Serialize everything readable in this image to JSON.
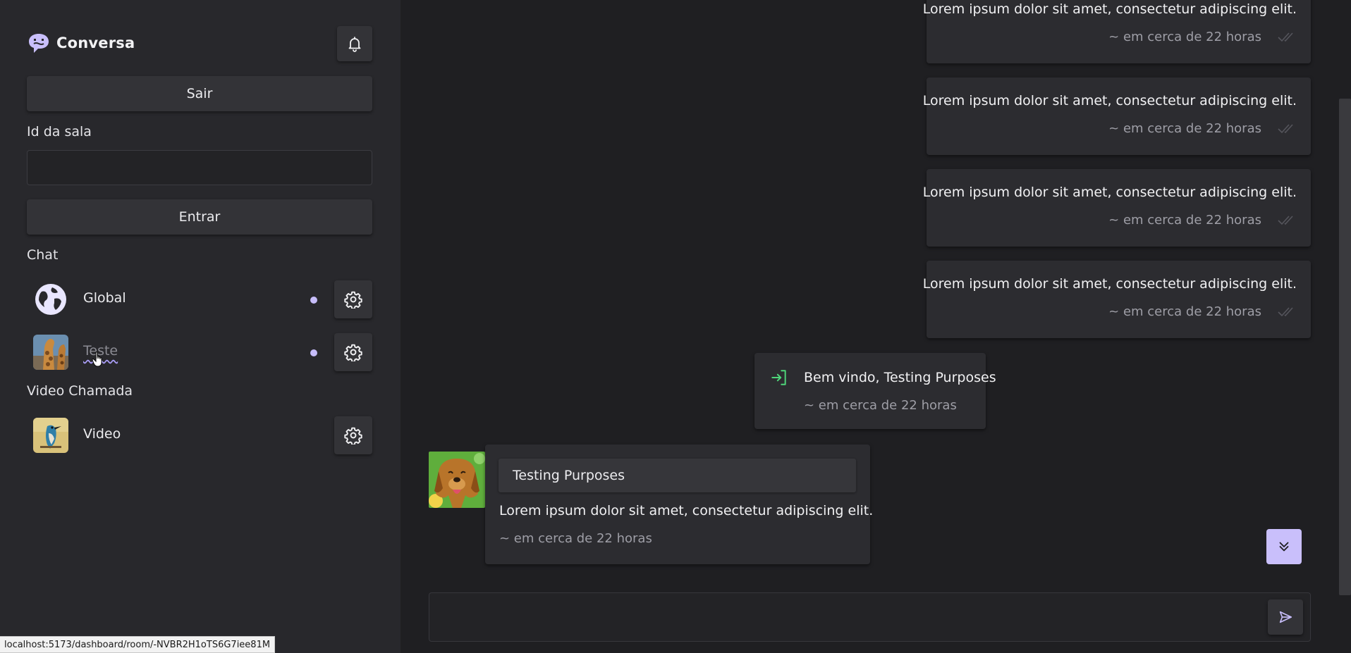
{
  "colors": {
    "background": "#1f1f22",
    "sidebar": "#28282c",
    "card": "#2c2c30",
    "accent": "#c9bffb",
    "enter_icon": "#4fd67a"
  },
  "sidebar": {
    "brand": {
      "name": "Conversa",
      "icon": "chat-bubble-logo-icon"
    },
    "notifications_icon": "bell-icon",
    "logout_label": "Sair",
    "room_id": {
      "label": "Id da sala",
      "value": "",
      "placeholder": ""
    },
    "enter_label": "Entrar",
    "chat_section_label": "Chat",
    "chat_rooms": [
      {
        "name": "Global",
        "avatar": "globe-icon",
        "unread": true,
        "settings_icon": "gear-icon"
      },
      {
        "name": "Teste",
        "avatar": "giraffe-photo",
        "unread": true,
        "settings_icon": "gear-icon"
      }
    ],
    "video_section_label": "Video Chamada",
    "video_rooms": [
      {
        "name": "Video",
        "avatar": "bird-photo",
        "settings_icon": "gear-icon"
      }
    ]
  },
  "chat": {
    "own_messages": [
      {
        "text": "Lorem ipsum dolor sit amet, consectetur adipiscing elit.",
        "time": "~ em cerca de 22 horas"
      },
      {
        "text": "Lorem ipsum dolor sit amet, consectetur adipiscing elit.",
        "time": "~ em cerca de 22 horas"
      },
      {
        "text": "Lorem ipsum dolor sit amet, consectetur adipiscing elit.",
        "time": "~ em cerca de 22 horas"
      },
      {
        "text": "Lorem ipsum dolor sit amet, consectetur adipiscing elit.",
        "time": "~ em cerca de 22 horas"
      }
    ],
    "system_message": {
      "text": "Bem vindo, Testing Purposes",
      "time": "~ em cerca de 22 horas",
      "icon": "login-arrow-icon"
    },
    "other_message": {
      "author": "Testing Purposes",
      "text": "Lorem ipsum dolor sit amet, consectetur adipiscing elit.",
      "time": "~ em cerca de 22 horas",
      "avatar": "dog-photo"
    },
    "scroll_down_icon": "chevrons-down-icon",
    "composer": {
      "value": "",
      "placeholder": "",
      "send_icon": "send-icon"
    }
  },
  "status_bar": {
    "url": "localhost:5173/dashboard/room/-NVBR2H1oTS6G7iee81M"
  }
}
